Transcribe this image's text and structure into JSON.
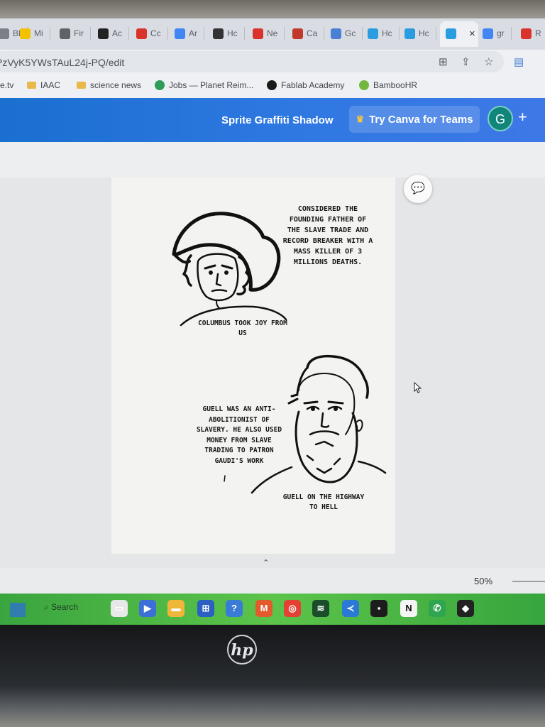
{
  "browser": {
    "tabs": [
      {
        "label": "Bl",
        "icon": "grid-icon",
        "color": "#7b8088"
      },
      {
        "label": "Mi",
        "icon": "m-logo-icon",
        "color": "#f2c200"
      },
      {
        "label": "Fir",
        "icon": "globe-icon",
        "color": "#5f6368"
      },
      {
        "label": "Ac",
        "icon": "black-square-icon",
        "color": "#222222"
      },
      {
        "label": "Cc",
        "icon": "red-pattern-icon",
        "color": "#d9332b"
      },
      {
        "label": "Ar",
        "icon": "google-icon",
        "color": "#4285f4"
      },
      {
        "label": "Hc",
        "icon": "hc-icon",
        "color": "#333333"
      },
      {
        "label": "Ne",
        "icon": "red-pattern-icon",
        "color": "#d9332b"
      },
      {
        "label": "Ca",
        "icon": "bag-icon",
        "color": "#c0392b"
      },
      {
        "label": "Gc",
        "icon": "calendar-icon",
        "color": "#4a7fd4"
      },
      {
        "label": "Hc",
        "icon": "canva-icon",
        "color": "#2a9de0"
      },
      {
        "label": "Hc",
        "icon": "canva-icon",
        "color": "#2a9de0"
      },
      {
        "label": "",
        "icon": "canva-icon",
        "color": "#2a9de0"
      },
      {
        "label": "gr",
        "icon": "google-icon",
        "color": "#4285f4"
      },
      {
        "label": "R",
        "icon": "r-logo-icon",
        "color": "#d9332b"
      }
    ],
    "active_tab_close": "×",
    "url": "PzVyK5YWsTAuL24j-PQ/edit",
    "bookmarks": [
      {
        "label": "e.tv",
        "icon": ""
      },
      {
        "label": "IAAC",
        "icon": "folder-icon"
      },
      {
        "label": "science news",
        "icon": "folder-icon"
      },
      {
        "label": "Jobs — Planet Reim...",
        "icon": "leaf-icon"
      },
      {
        "label": "Fablab Academy",
        "icon": "dark-circle-icon"
      },
      {
        "label": "BambooHR",
        "icon": "green-circle-icon"
      }
    ]
  },
  "canva": {
    "doc_title": "Sprite Graffiti Shadow",
    "teams_button": "Try Canva for Teams",
    "avatar_letter": "G",
    "plus": "+",
    "zoom": "50%",
    "page": {
      "caption_top": "CONSIDERED THE FOUNDING FATHER OF THE SLAVE TRADE AND RECORD BREAKER WITH A MASS KILLER OF 3 MILLIONS DEATHS.",
      "caption_columbus": "COLUMBUS TOOK JOY FROM US",
      "caption_guell_text": "GUELL WAS AN ANTI-ABOLITIONIST OF SLAVERY. HE ALSO USED MONEY FROM SLAVE TRADING TO PATRON GAUDI'S WORK",
      "caption_guell": "GUELL ON THE HIGHWAY TO HELL"
    }
  },
  "taskbar": {
    "search_label": "Search",
    "apps": [
      "file-explorer-icon",
      "zoom-icon",
      "folder-icon",
      "store-icon",
      "help-icon",
      "mail-icon",
      "chrome-icon",
      "wifi-icon",
      "vscode-icon",
      "sticky-icon",
      "notion-icon",
      "whatsapp-icon",
      "inkscape-icon"
    ]
  },
  "device": {
    "brand": "hp"
  }
}
